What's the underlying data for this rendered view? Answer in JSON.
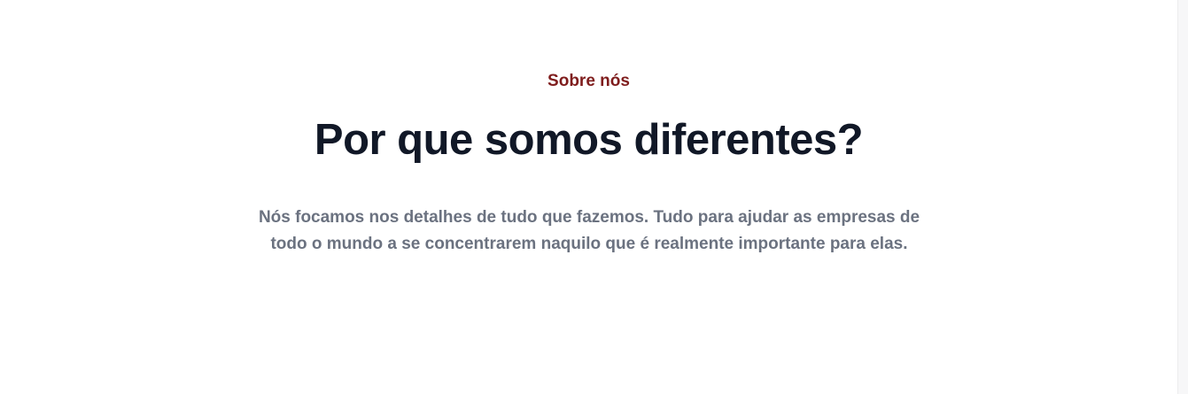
{
  "section": {
    "eyebrow": "Sobre nós",
    "title": "Por que somos diferentes?",
    "description": "Nós focamos nos detalhes de tudo que fazemos. Tudo para ajudar as empresas de todo o mundo a se concentrarem naquilo que é realmente importante para elas."
  },
  "colors": {
    "eyebrow": "#7f1d1d",
    "title": "#111827",
    "description": "#6b7280",
    "background": "#ffffff"
  }
}
